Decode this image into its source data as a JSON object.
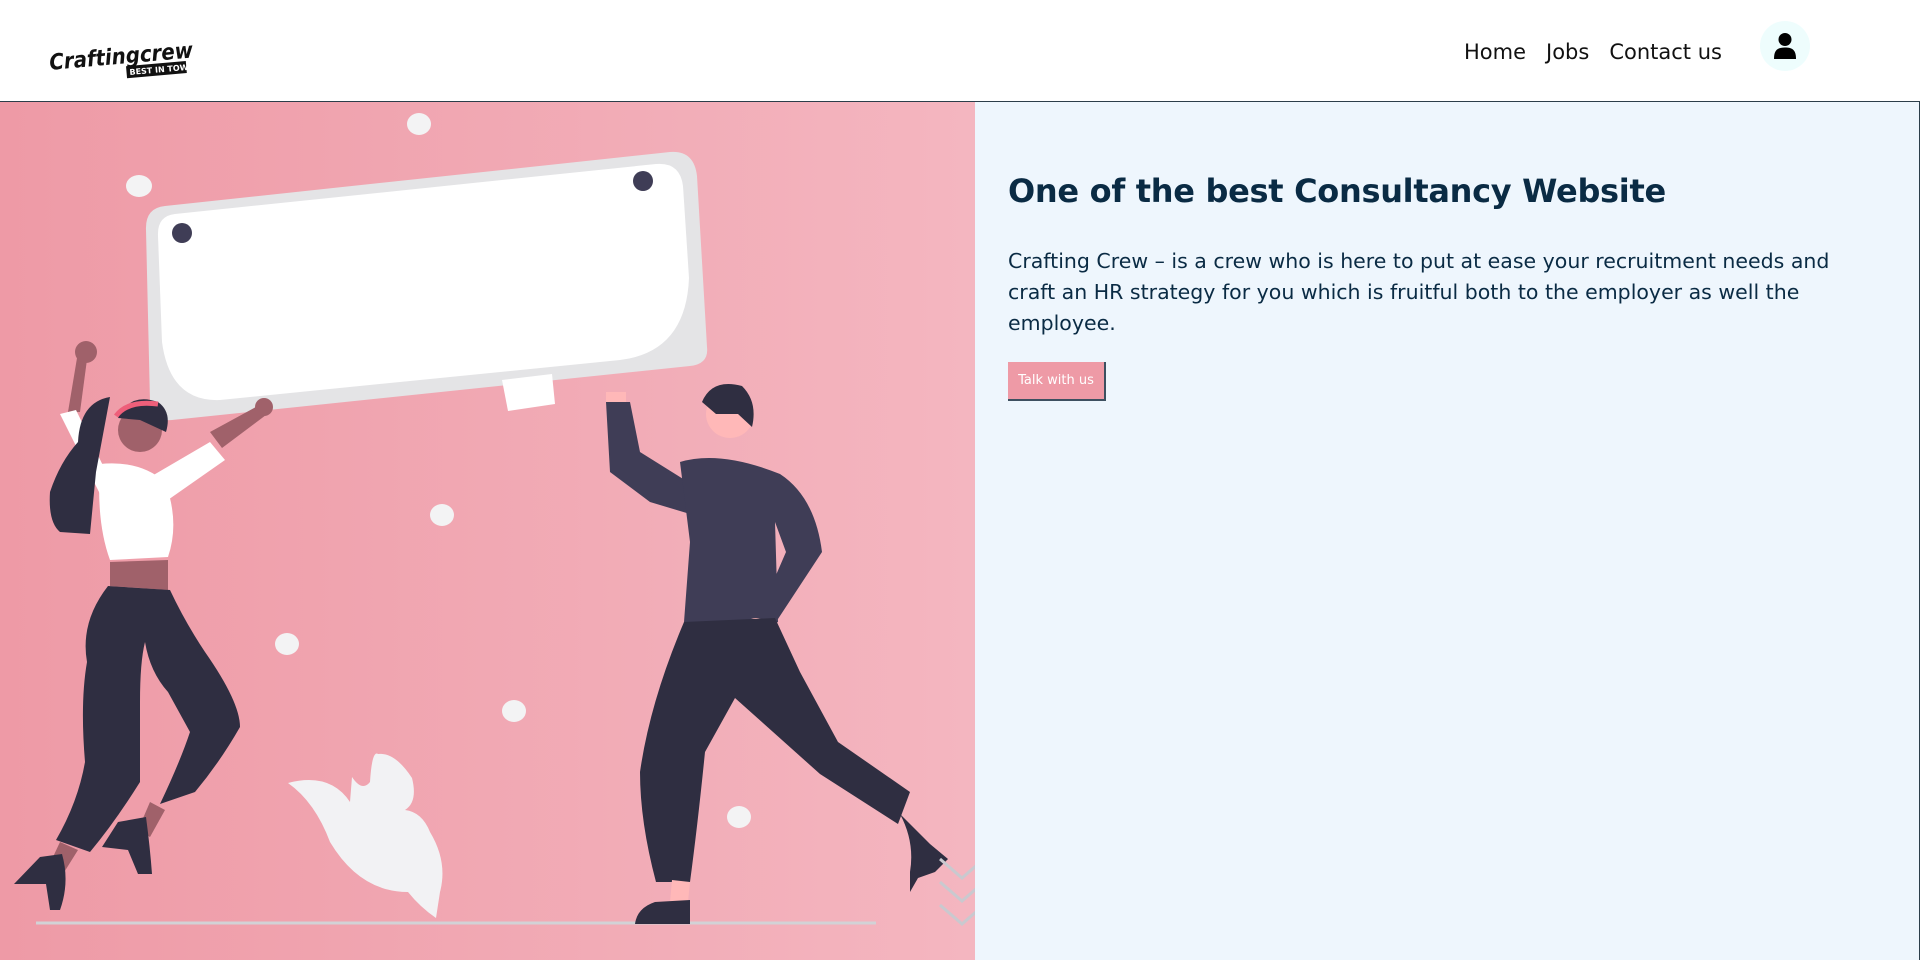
{
  "header": {
    "logo": {
      "wordmark": "Craftingcrew",
      "tagline": "BEST IN TOWN!"
    },
    "nav": [
      {
        "label": "Home"
      },
      {
        "label": "Jobs"
      },
      {
        "label": "Contact us"
      }
    ],
    "profile_icon": "user-icon"
  },
  "hero": {
    "title": "One of the best Consultancy Website",
    "description": "Crafting Crew – is a crew who is here to put at ease your recruitment needs and craft an HR strategy for you which is fruitful both to the employer as well the employee.",
    "cta_label": "Talk with us",
    "illustration": "celebrating-people-holding-sign",
    "scroll_icon": "chevron-down-icon"
  },
  "colors": {
    "navy": "#0a2b44",
    "pink": "#ee9aa6",
    "light_blue": "#eef6fd",
    "dark_figure": "#2f2e41"
  }
}
